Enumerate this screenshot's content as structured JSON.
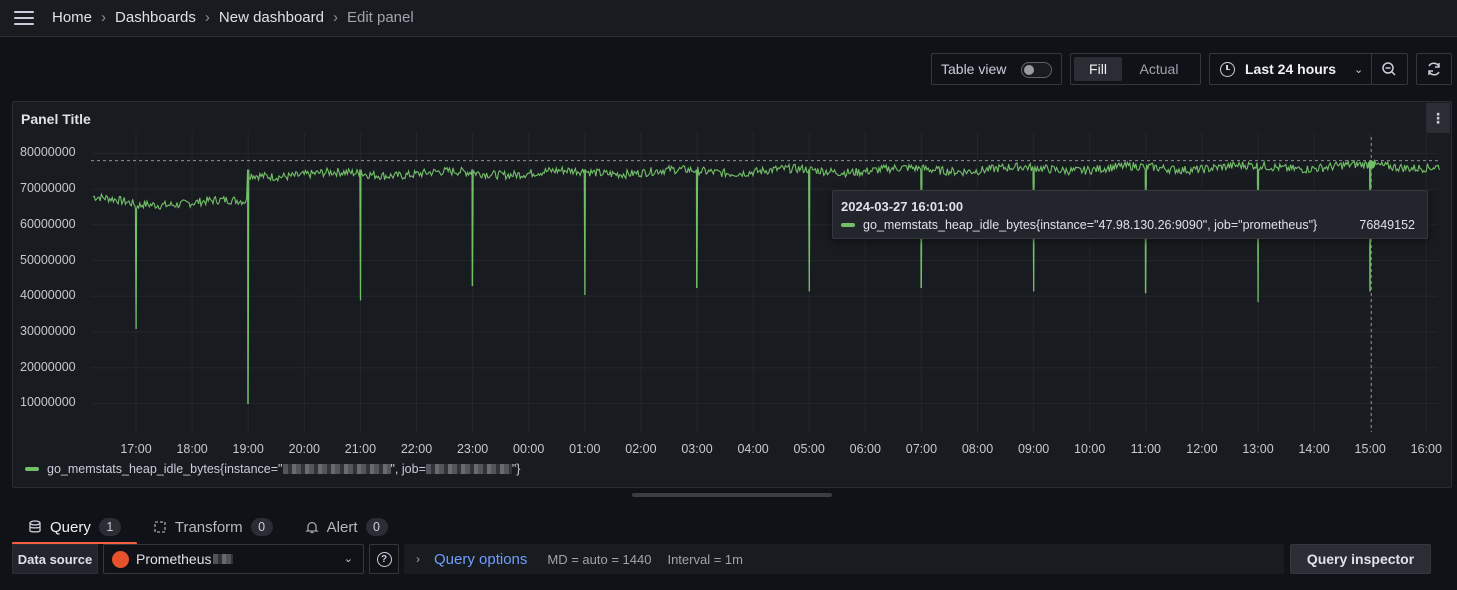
{
  "breadcrumb": {
    "items": [
      "Home",
      "Dashboards",
      "New dashboard",
      "Edit panel"
    ],
    "separator": "›"
  },
  "toolbar": {
    "table_view_label": "Table view",
    "table_view_on": false,
    "fill_label": "Fill",
    "actual_label": "Actual",
    "time_range_label": "Last 24 hours"
  },
  "panel": {
    "title": "Panel Title",
    "menu_glyph": "⋮"
  },
  "chart_data": {
    "type": "line",
    "title": "Panel Title",
    "xlabel": "",
    "ylabel": "",
    "y_ticks": [
      80000000,
      70000000,
      60000000,
      50000000,
      40000000,
      30000000,
      20000000,
      10000000
    ],
    "y_tick_labels": [
      "80000000",
      "70000000",
      "60000000",
      "50000000",
      "40000000",
      "30000000",
      "20000000",
      "10000000"
    ],
    "ylim": [
      2000000,
      86000000
    ],
    "x_tick_labels": [
      "17:00",
      "18:00",
      "19:00",
      "20:00",
      "21:00",
      "22:00",
      "23:00",
      "00:00",
      "01:00",
      "02:00",
      "03:00",
      "04:00",
      "05:00",
      "06:00",
      "07:00",
      "08:00",
      "09:00",
      "10:00",
      "11:00",
      "12:00",
      "13:00",
      "14:00",
      "15:00",
      "16:00"
    ],
    "grid": true,
    "legend_position": "bottom-left",
    "series": [
      {
        "name": "go_memstats_heap_idle_bytes{instance=\"…\", job=\"…\"}",
        "color": "#73bf69",
        "baseline_segments": [
          {
            "from_hour": 0.0,
            "to_hour": 1.1,
            "start": 68000000,
            "end": 65500000
          },
          {
            "from_hour": 1.1,
            "to_hour": 3.0,
            "start": 66000000,
            "end": 66500000
          },
          {
            "from_hour": 3.0,
            "to_hour": 24.2,
            "start": 74000000,
            "end": 76500000
          }
        ],
        "dips": [
          {
            "hour": 1.0,
            "value": 31000000
          },
          {
            "hour": 3.0,
            "value": 10000000
          },
          {
            "hour": 5.0,
            "value": 39000000
          },
          {
            "hour": 7.0,
            "value": 43000000
          },
          {
            "hour": 9.0,
            "value": 40500000
          },
          {
            "hour": 11.0,
            "value": 42500000
          },
          {
            "hour": 13.0,
            "value": 41500000
          },
          {
            "hour": 15.0,
            "value": 42500000
          },
          {
            "hour": 17.0,
            "value": 41500000
          },
          {
            "hour": 19.0,
            "value": 41000000
          },
          {
            "hour": 21.0,
            "value": 38500000
          },
          {
            "hour": 23.0,
            "value": 41500000
          }
        ]
      }
    ],
    "threshold_line": 78000000,
    "cursor": {
      "time": "2024-03-27 16:01:00",
      "hour": 23.02,
      "value": 76849152
    }
  },
  "legend": {
    "prefix": "go_memstats_heap_idle_bytes{instance=\"",
    "middle": "\", job=",
    "suffix": "\"}"
  },
  "tooltip": {
    "time": "2024-03-27 16:01:00",
    "series_label": "go_memstats_heap_idle_bytes{instance=\"47.98.130.26:9090\", job=\"prometheus\"}",
    "value": "76849152"
  },
  "tabs": [
    {
      "label": "Query",
      "count": "1",
      "icon": "database-icon",
      "active": true
    },
    {
      "label": "Transform",
      "count": "0",
      "icon": "transform-icon",
      "active": false
    },
    {
      "label": "Alert",
      "count": "0",
      "icon": "bell-icon",
      "active": false
    }
  ],
  "query": {
    "datasource_label": "Data source",
    "datasource_value": "Prometheus",
    "options_title": "Query options",
    "md": "MD = auto = 1440",
    "interval": "Interval = 1m",
    "inspector_label": "Query inspector"
  }
}
